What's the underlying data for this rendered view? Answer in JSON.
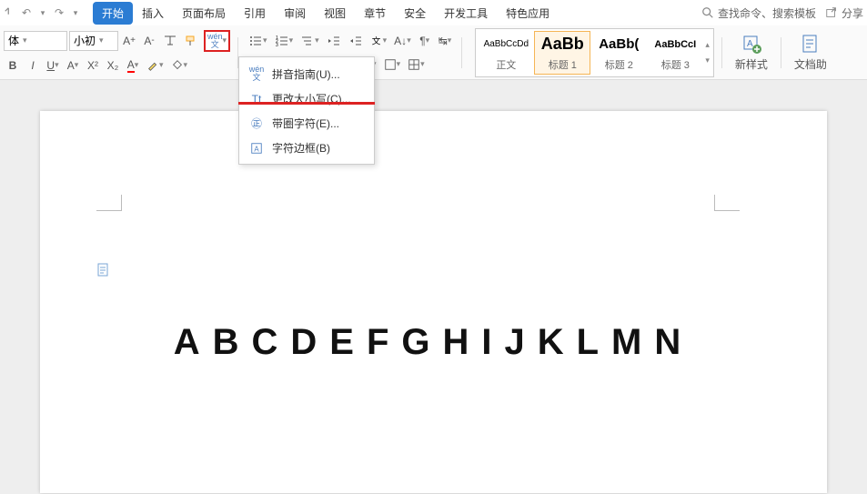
{
  "qat": {
    "undo": "↶",
    "redo": "↷"
  },
  "tabs": [
    "开始",
    "插入",
    "页面布局",
    "引用",
    "审阅",
    "视图",
    "章节",
    "安全",
    "开发工具",
    "特色应用"
  ],
  "active_tab": 0,
  "search_placeholder": "查找命令、搜索模板",
  "share_label": "分享",
  "font": {
    "name": "体",
    "size": "小初"
  },
  "paste_label": "",
  "wen_label": "wén",
  "dropdown": {
    "items": [
      {
        "icon": "wen",
        "label": "拼音指南(U)..."
      },
      {
        "icon": "case",
        "label": "更改大小写(C)..."
      },
      {
        "icon": "circle",
        "label": "带圈字符(E)..."
      },
      {
        "icon": "box",
        "label": "字符边框(B)"
      }
    ]
  },
  "styles": [
    {
      "preview": "AaBbCcDd",
      "label": "正文",
      "sel": false,
      "size": "10px"
    },
    {
      "preview": "AaBb",
      "label": "标题 1",
      "sel": true,
      "size": "18px",
      "bold": true
    },
    {
      "preview": "AaBb(",
      "label": "标题 2",
      "sel": false,
      "size": "15px",
      "bold": true
    },
    {
      "preview": "AaBbCcI",
      "label": "标题 3",
      "sel": false,
      "size": "11px",
      "bold": true
    }
  ],
  "new_style_label": "新样式",
  "doc_help_label": "文档助",
  "document_text": "ABCDEFGHIJKLMN"
}
